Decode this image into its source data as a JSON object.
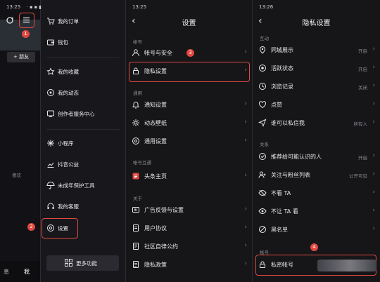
{
  "panel1": {
    "time": "13:25",
    "badge": "1",
    "follow_button": "+ 朋友",
    "like_label": "喜欢",
    "bottom_left": "息",
    "bottom_right": "我"
  },
  "panel2": {
    "items": [
      {
        "label": "我的订单",
        "icon": "cart-icon"
      },
      {
        "label": "钱包",
        "icon": "wallet-icon"
      },
      {
        "label": "我的收藏",
        "icon": "star-icon"
      },
      {
        "label": "我的动态",
        "icon": "activity-icon"
      },
      {
        "label": "创作者服务中心",
        "icon": "creator-icon"
      },
      {
        "label": "小程序",
        "icon": "miniapp-icon"
      },
      {
        "label": "抖音公益",
        "icon": "charity-icon"
      },
      {
        "label": "未成年保护工具",
        "icon": "umbrella-icon"
      },
      {
        "label": "我的客服",
        "icon": "headset-icon"
      },
      {
        "label": "设置",
        "icon": "settings-icon"
      }
    ],
    "badge": "2",
    "more_button": "更多功能"
  },
  "panel3": {
    "time": "13:25",
    "title": "设置",
    "sections": [
      {
        "title": "帐号",
        "items": [
          "帐号与安全",
          "隐私设置"
        ]
      },
      {
        "title": "通用",
        "items": [
          "通知设置",
          "动态壁纸",
          "通用设置"
        ]
      },
      {
        "title": "帐号互通",
        "items": [
          "头条主页"
        ]
      },
      {
        "title": "关于",
        "items": [
          "广告反馈与设置",
          "用户协议",
          "社区自律公约",
          "隐私政策"
        ]
      }
    ],
    "badge": "3"
  },
  "panel4": {
    "time": "13:26",
    "title": "隐私设置",
    "sections": [
      {
        "title": "互动",
        "items": [
          {
            "label": "同城展示",
            "value": "开启"
          },
          {
            "label": "活跃状态",
            "value": "开启"
          },
          {
            "label": "浏览记录",
            "value": "关闭"
          },
          {
            "label": "点赞",
            "value": ""
          },
          {
            "label": "谁可以私信我",
            "value": "所有人"
          }
        ]
      },
      {
        "title": "关系",
        "items": [
          {
            "label": "推荐给可能认识的人",
            "value": "开启"
          },
          {
            "label": "关注与粉丝列表",
            "value": "公开可见"
          },
          {
            "label": "不看 TA",
            "value": ""
          },
          {
            "label": "不让 TA 看",
            "value": ""
          },
          {
            "label": "黑名单",
            "value": ""
          }
        ]
      },
      {
        "title": "帐号",
        "items": [
          {
            "label": "私密帐号",
            "value": ""
          }
        ]
      }
    ],
    "badge": "4"
  },
  "colors": {
    "accent_red": "#e0483f",
    "background": "#161619",
    "muted": "#8a8a90"
  }
}
